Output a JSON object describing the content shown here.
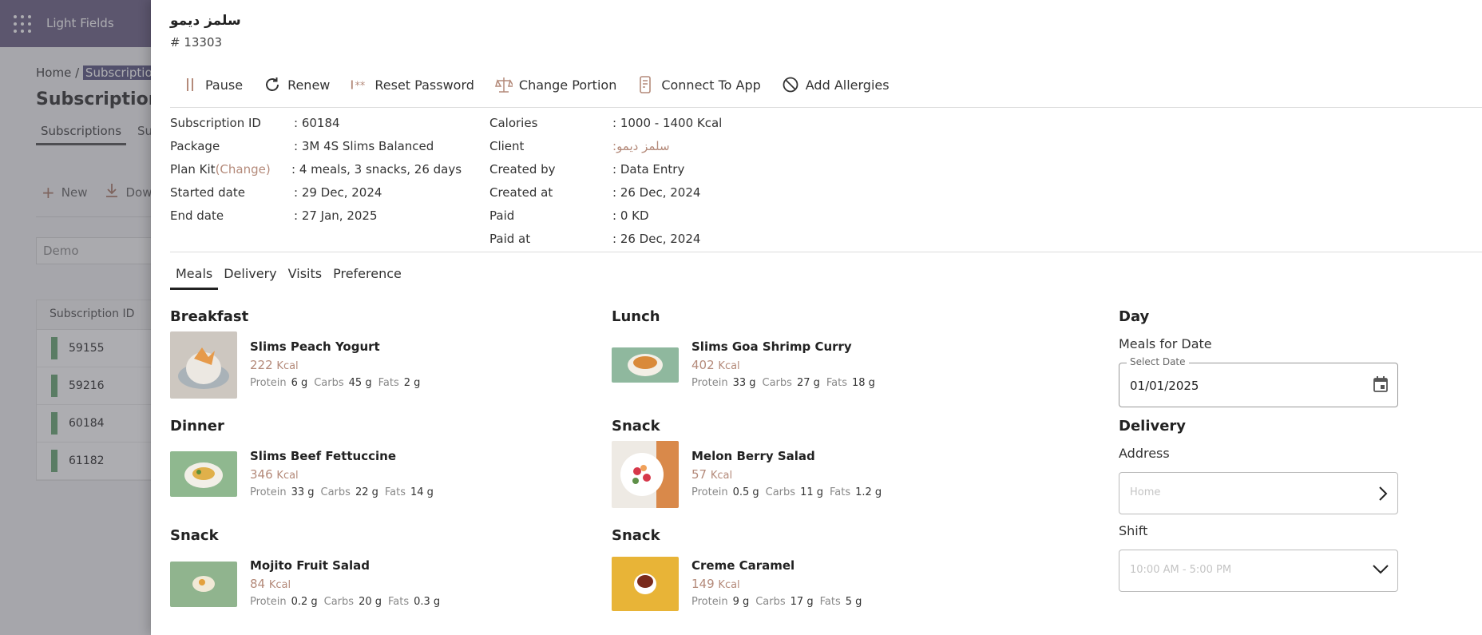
{
  "background": {
    "app_title": "Light Fields",
    "breadcrumb_home": "Home",
    "breadcrumb_sep": "/",
    "breadcrumb_current": "Subscriptions",
    "heading": "Subscriptions",
    "tabs": [
      "Subscriptions",
      "Sub"
    ],
    "actions": {
      "new_label": "New",
      "download_label": "Dow"
    },
    "search_value": "Demo",
    "table_header": "Subscription ID",
    "rows": [
      "59155",
      "59216",
      "60184",
      "61182"
    ]
  },
  "drawer": {
    "client_name": "سلمز ديمو",
    "client_code": "# 13303",
    "toolbar": {
      "pause": "Pause",
      "renew": "Renew",
      "reset_password": "Reset Password",
      "change_portion": "Change Portion",
      "connect_app": "Connect To App",
      "add_allergies": "Add Allergies"
    },
    "info_left": [
      {
        "label": "Subscription ID",
        "value": ": 60184"
      },
      {
        "label": "Package",
        "value": ": 3M 4S Slims Balanced"
      },
      {
        "label": "Plan Kit",
        "link": "(Change)",
        "value": ": 4 meals, 3 snacks, 26 days"
      },
      {
        "label": "Started date",
        "value": ": 29 Dec, 2024"
      },
      {
        "label": "End date",
        "value": ": 27 Jan, 2025"
      }
    ],
    "info_right": [
      {
        "label": "Calories",
        "value": ": 1000 - 1400 Kcal"
      },
      {
        "label": "Client",
        "value": ":سلمز ديمو"
      },
      {
        "label": "Created by",
        "value": ": Data Entry"
      },
      {
        "label": "Created at",
        "value": ": 26 Dec, 2024"
      },
      {
        "label": "Paid",
        "value": ": 0 KD"
      },
      {
        "label": "Paid at",
        "value": ": 26 Dec, 2024"
      }
    ],
    "tabs": [
      "Meals",
      "Delivery",
      "Visits",
      "Preference"
    ],
    "macro_labels": {
      "protein": "Protein",
      "carbs": "Carbs",
      "fats": "Fats",
      "kcal_unit": "Kcal"
    },
    "meals": [
      {
        "section": "Breakfast",
        "name": "Slims Peach Yogurt",
        "kcal": "222",
        "protein": "6 g",
        "carbs": "45 g",
        "fats": "2 g",
        "img_bg": "#c9c4bd"
      },
      {
        "section": "Lunch",
        "name": "Slims Goa Shrimp Curry",
        "kcal": "402",
        "protein": "33 g",
        "carbs": "27 g",
        "fats": "18 g",
        "img_bg": "#8fb89e"
      },
      {
        "section": "Dinner",
        "name": "Slims Beef Fettuccine",
        "kcal": "346",
        "protein": "33 g",
        "carbs": "22 g",
        "fats": "14 g",
        "img_bg": "#8fb88f"
      },
      {
        "section": "Snack",
        "name": "Melon Berry Salad",
        "kcal": "57",
        "protein": "0.5 g",
        "carbs": "11 g",
        "fats": "1.2 g",
        "img_bg": "#d9a27a"
      },
      {
        "section": "Snack",
        "name": "Mojito Fruit Salad",
        "kcal": "84",
        "protein": "0.2 g",
        "carbs": "20 g",
        "fats": "0.3 g",
        "img_bg": "#90b48e"
      },
      {
        "section": "Snack",
        "name": "Creme Caramel",
        "kcal": "149",
        "protein": "9 g",
        "carbs": "17 g",
        "fats": "5 g",
        "img_bg": "#e8b437"
      }
    ],
    "side": {
      "day_title": "Day",
      "meals_for_date": "Meals for Date",
      "select_date_label": "Select Date",
      "date_value": "01/01/2025",
      "delivery_title": "Delivery",
      "address_label": "Address",
      "address_placeholder": "Home",
      "shift_label": "Shift",
      "shift_placeholder": "10:00 AM - 5:00 PM"
    }
  },
  "colors": {
    "accent": "#b48a7a",
    "topbar": "#7c7393"
  }
}
